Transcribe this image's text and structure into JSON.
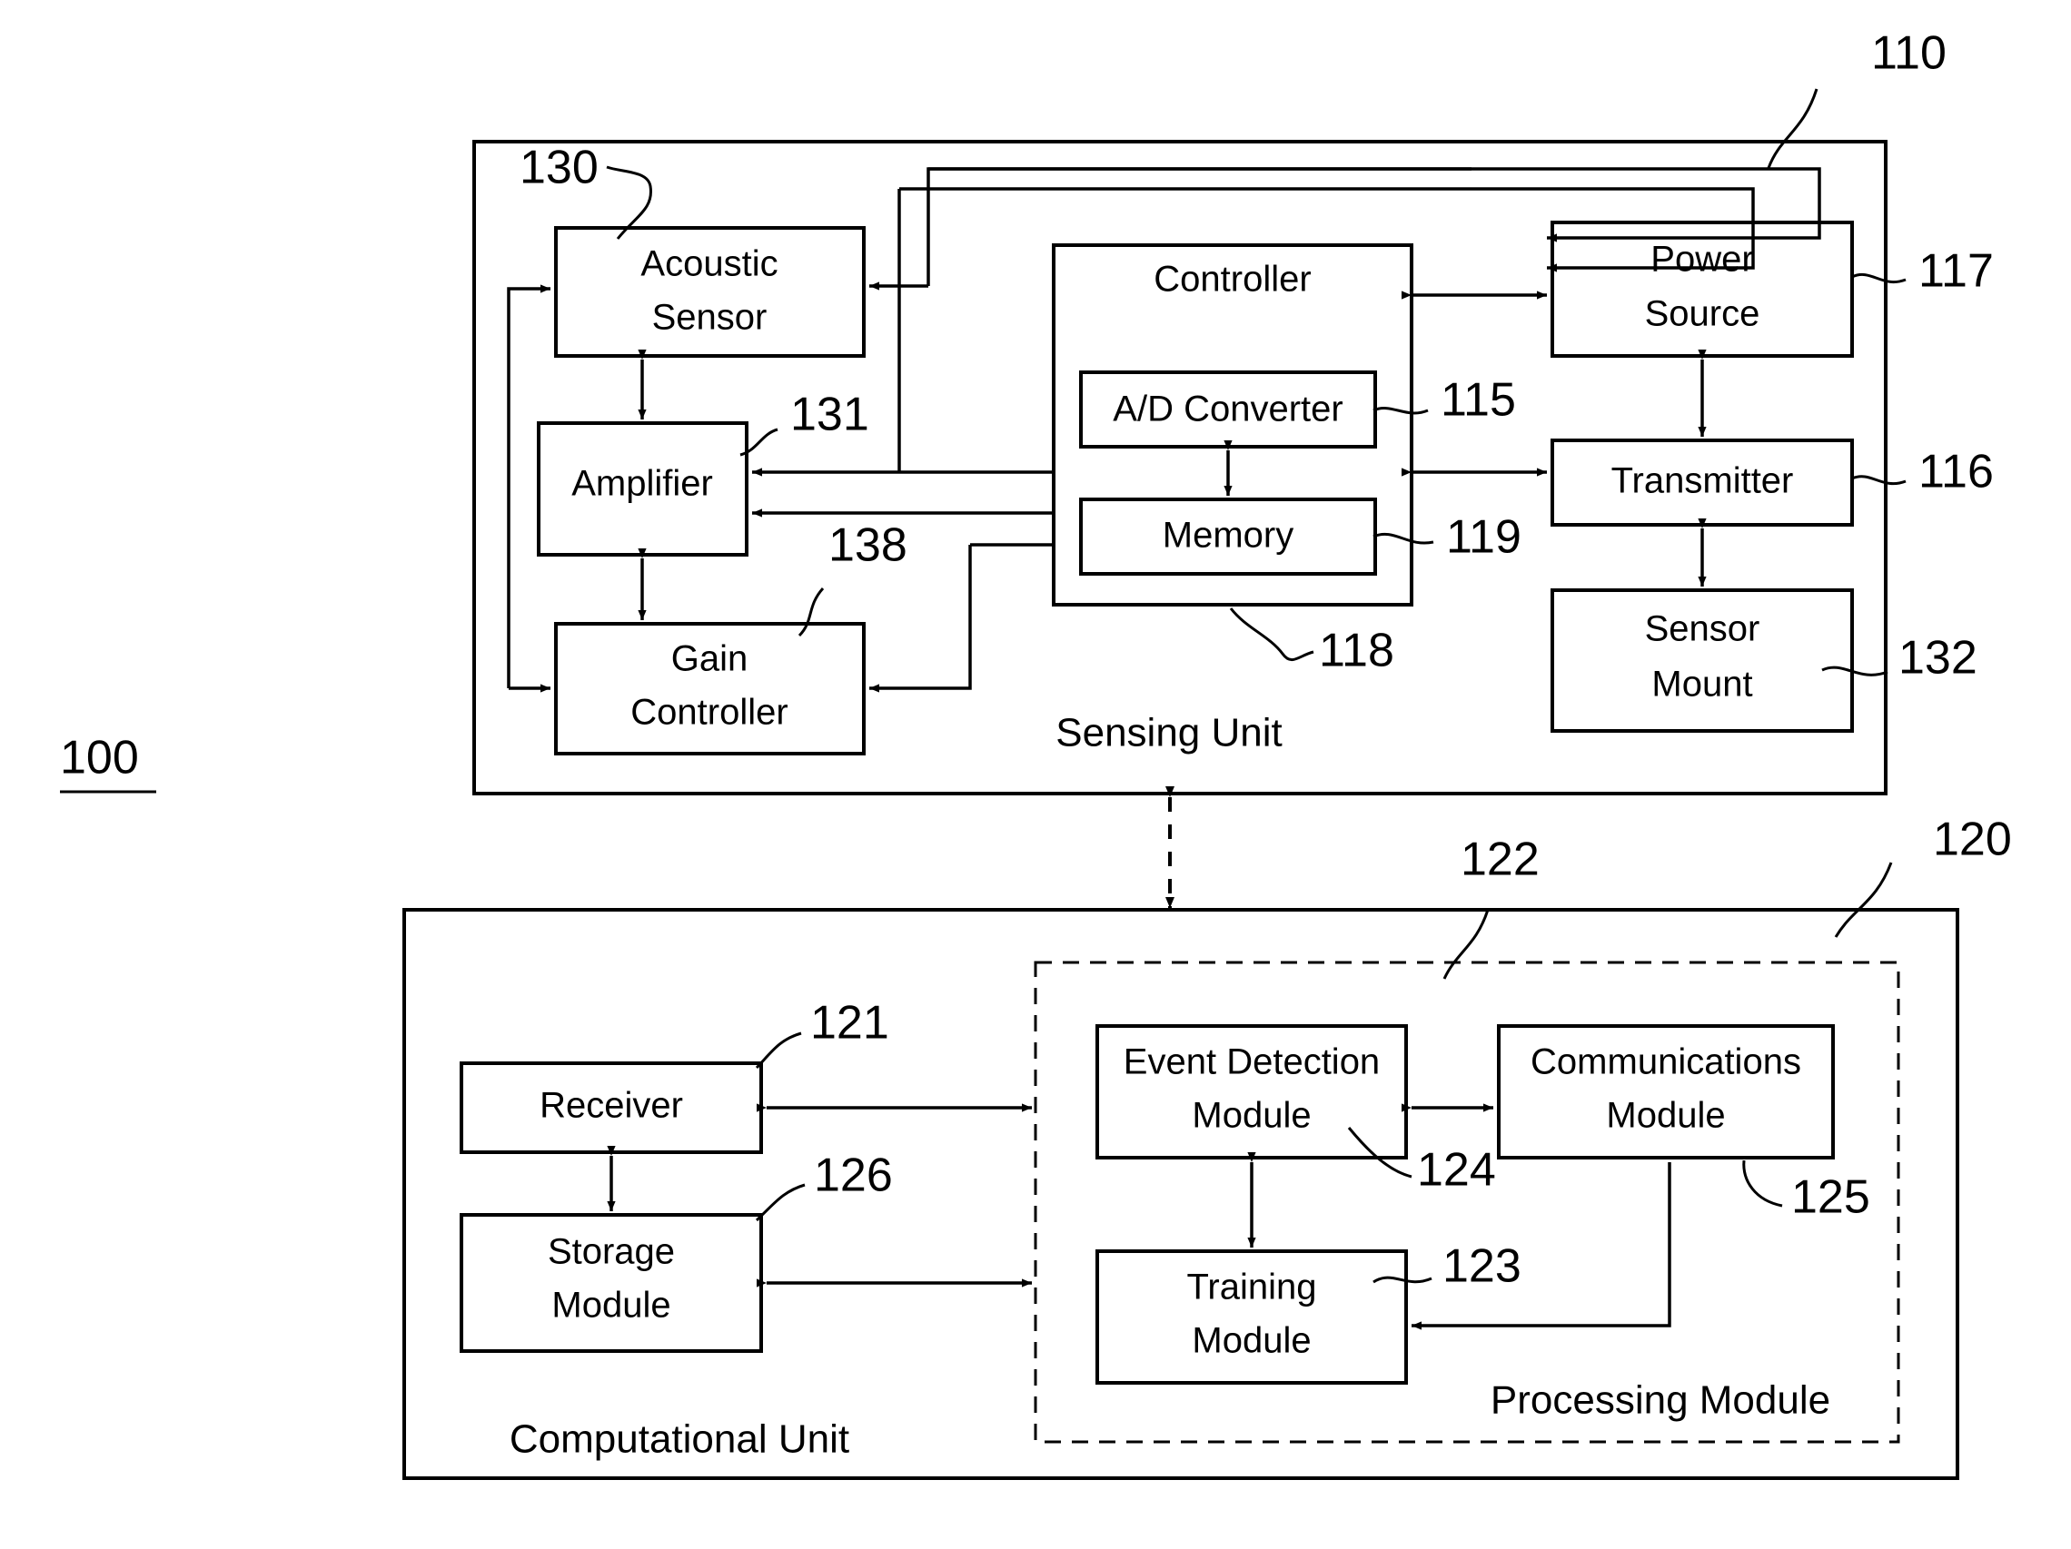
{
  "figure": {
    "system_number": "100",
    "sensing_unit": {
      "label": "Sensing Unit",
      "ref": "110",
      "blocks": [
        {
          "id": "acoustic_sensor",
          "label_line1": "Acoustic",
          "label_line2": "Sensor",
          "ref": "130"
        },
        {
          "id": "amplifier",
          "label_line1": "Amplifier",
          "label_line2": "",
          "ref": "131"
        },
        {
          "id": "gain_controller",
          "label_line1": "Gain",
          "label_line2": "Controller",
          "ref": "138"
        },
        {
          "id": "controller",
          "label_line1": "Controller",
          "label_line2": "",
          "ref": "118"
        },
        {
          "id": "ad_converter",
          "label_line1": "A/D Converter",
          "label_line2": "",
          "ref": "115"
        },
        {
          "id": "memory",
          "label_line1": "Memory",
          "label_line2": "",
          "ref": "119"
        },
        {
          "id": "power_source",
          "label_line1": "Power",
          "label_line2": "Source",
          "ref": "117"
        },
        {
          "id": "transmitter",
          "label_line1": "Transmitter",
          "label_line2": "",
          "ref": "116"
        },
        {
          "id": "sensor_mount",
          "label_line1": "Sensor",
          "label_line2": "Mount",
          "ref": "132"
        }
      ]
    },
    "computational_unit": {
      "label": "Computational Unit",
      "ref": "120",
      "blocks": [
        {
          "id": "receiver",
          "label_line1": "Receiver",
          "label_line2": "",
          "ref": "121"
        },
        {
          "id": "storage_module",
          "label_line1": "Storage",
          "label_line2": "Module",
          "ref": "126"
        }
      ],
      "processing_module": {
        "label": "Processing Module",
        "ref": "122",
        "blocks": [
          {
            "id": "event_detection_module",
            "label_line1": "Event Detection",
            "label_line2": "Module",
            "ref": "124"
          },
          {
            "id": "communications_module",
            "label_line1": "Communications",
            "label_line2": "Module",
            "ref": "125"
          },
          {
            "id": "training_module",
            "label_line1": "Training",
            "label_line2": "Module",
            "ref": "123"
          }
        ]
      }
    }
  },
  "text": {
    "n100": "100",
    "n110": "110",
    "n115": "115",
    "n116": "116",
    "n117": "117",
    "n118": "118",
    "n119": "119",
    "n120": "120",
    "n121": "121",
    "n122": "122",
    "n123": "123",
    "n124": "124",
    "n125": "125",
    "n126": "126",
    "n130": "130",
    "n131": "131",
    "n132": "132",
    "n138": "138",
    "acoustic1": "Acoustic",
    "acoustic2": "Sensor",
    "amplifier": "Amplifier",
    "gain1": "Gain",
    "gain2": "Controller",
    "controller": "Controller",
    "adc": "A/D Converter",
    "memory": "Memory",
    "power1": "Power",
    "power2": "Source",
    "transmitter": "Transmitter",
    "mount1": "Sensor",
    "mount2": "Mount",
    "sensing_unit": "Sensing Unit",
    "receiver": "Receiver",
    "storage1": "Storage",
    "storage2": "Module",
    "event1": "Event Detection",
    "event2": "Module",
    "comms1": "Communications",
    "comms2": "Module",
    "training1": "Training",
    "training2": "Module",
    "processing_module": "Processing Module",
    "computational_unit": "Computational Unit"
  },
  "colors": {
    "line": "#000000",
    "background": "#ffffff"
  }
}
